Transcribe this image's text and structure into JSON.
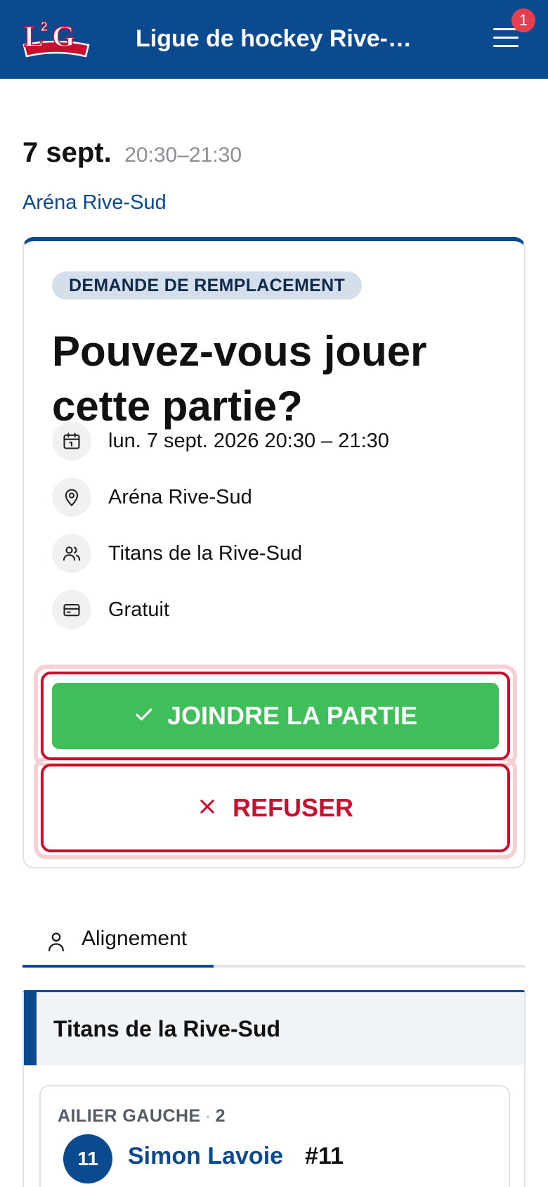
{
  "header": {
    "logo_text": "L2G",
    "title": "Ligue de hockey Rive-Sud",
    "notification_count": "1",
    "menu_icon": "hamburger-menu-icon"
  },
  "event": {
    "date": "7 sept.",
    "time_range": "20:30–21:30",
    "venue": "Aréna Rive-Sud"
  },
  "request_card": {
    "badge": "DEMANDE DE REMPLACEMENT",
    "title": "Pouvez-vous jouer cette partie?",
    "details": [
      {
        "icon": "calendar-icon",
        "text": "lun. 7 sept. 2026 20:30 – 21:30"
      },
      {
        "icon": "location-pin-icon",
        "text": "Aréna Rive-Sud"
      },
      {
        "icon": "users-icon",
        "text": "Titans de la Rive-Sud"
      },
      {
        "icon": "credit-card-icon",
        "text": "Gratuit"
      }
    ],
    "join_label": "JOINDRE LA PARTIE",
    "refuse_label": "REFUSER",
    "colors": {
      "accent": "#0b4a8f",
      "join": "#3fbe5a",
      "refuse": "#c8102e"
    }
  },
  "tabs": [
    {
      "label": "Alignement",
      "icon": "user-icon",
      "active": true
    }
  ],
  "lineup": {
    "team_name": "Titans de la Rive-Sud",
    "positions": [
      {
        "name": "AILIER GAUCHE",
        "count": "2",
        "players": [
          {
            "avatar": "11",
            "name": "Simon Lavoie",
            "number": "#11"
          }
        ]
      }
    ]
  }
}
